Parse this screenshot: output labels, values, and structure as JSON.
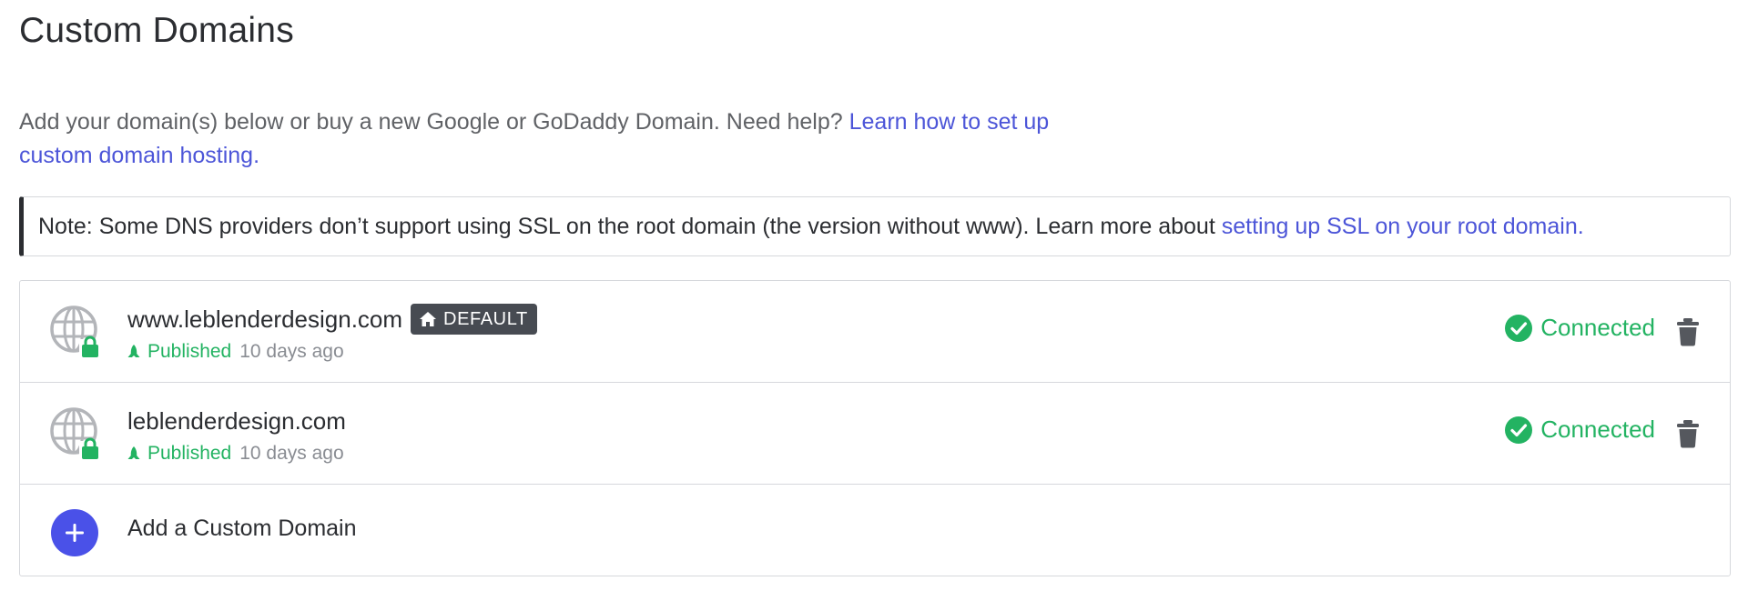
{
  "page": {
    "title": "Custom Domains",
    "intro_text": "Add your domain(s) below or buy a new Google or GoDaddy Domain. Need help? ",
    "intro_link": "Learn how to set up custom domain hosting.",
    "note_text": "Note: Some DNS providers don’t support using SSL on the root domain (the version without www). Learn more about ",
    "note_link": "setting up SSL on your root domain."
  },
  "domains": [
    {
      "name": "www.leblenderdesign.com",
      "badge": "DEFAULT",
      "published_label": "Published",
      "published_ago": "10 days ago",
      "status": "Connected"
    },
    {
      "name": "leblenderdesign.com",
      "published_label": "Published",
      "published_ago": "10 days ago",
      "status": "Connected"
    }
  ],
  "add_domain": {
    "label": "Add a Custom Domain"
  },
  "colors": {
    "link": "#4c55d8",
    "success": "#23b362",
    "accent": "#4a51e8",
    "badge_bg": "#474b52"
  },
  "icons": {
    "domain": "globe-lock-icon",
    "default": "home-icon",
    "published": "rocket-icon",
    "status": "check-circle-icon",
    "delete": "trash-icon",
    "add": "plus-icon"
  }
}
